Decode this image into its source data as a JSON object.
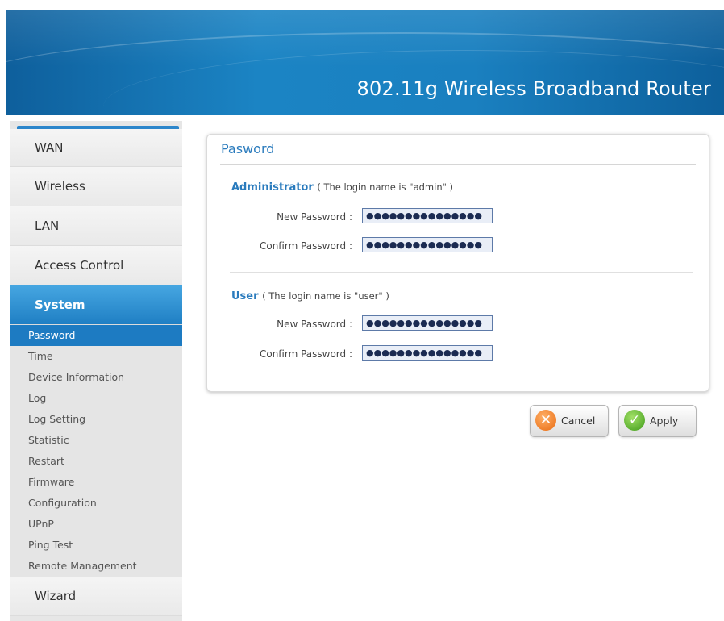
{
  "header": {
    "title": "802.11g Wireless Broadband Router"
  },
  "sidebar": {
    "items": [
      {
        "label": "WAN"
      },
      {
        "label": "Wireless"
      },
      {
        "label": "LAN"
      },
      {
        "label": "Access Control"
      },
      {
        "label": "System"
      }
    ],
    "system_subitems": [
      "Password",
      "Time",
      "Device Information",
      "Log",
      "Log Setting",
      "Statistic",
      "Restart",
      "Firmware",
      "Configuration",
      "UPnP",
      "Ping Test",
      "Remote Management"
    ],
    "wizard": "Wizard",
    "active_item": "System",
    "active_subitem": "Password"
  },
  "panel": {
    "title": "Pasword",
    "admin": {
      "title": "Administrator",
      "hint": "( The login name is \"admin\" )",
      "new_label": "New Password :",
      "confirm_label": "Confirm Password :",
      "new_value": "●●●●●●●●●●●●●●●",
      "confirm_value": "●●●●●●●●●●●●●●●"
    },
    "user": {
      "title": "User",
      "hint": "( The login name is \"user\" )",
      "new_label": "New Password :",
      "confirm_label": "Confirm Password :",
      "new_value": "●●●●●●●●●●●●●●●",
      "confirm_value": "●●●●●●●●●●●●●●●"
    }
  },
  "buttons": {
    "cancel": "Cancel",
    "apply": "Apply"
  },
  "icons": {
    "cancel": "x-icon",
    "apply": "check-icon"
  },
  "colors": {
    "accent": "#1d7bc2",
    "header": "#1b84c4",
    "cancel": "#e86a11",
    "apply": "#3d9a18"
  }
}
